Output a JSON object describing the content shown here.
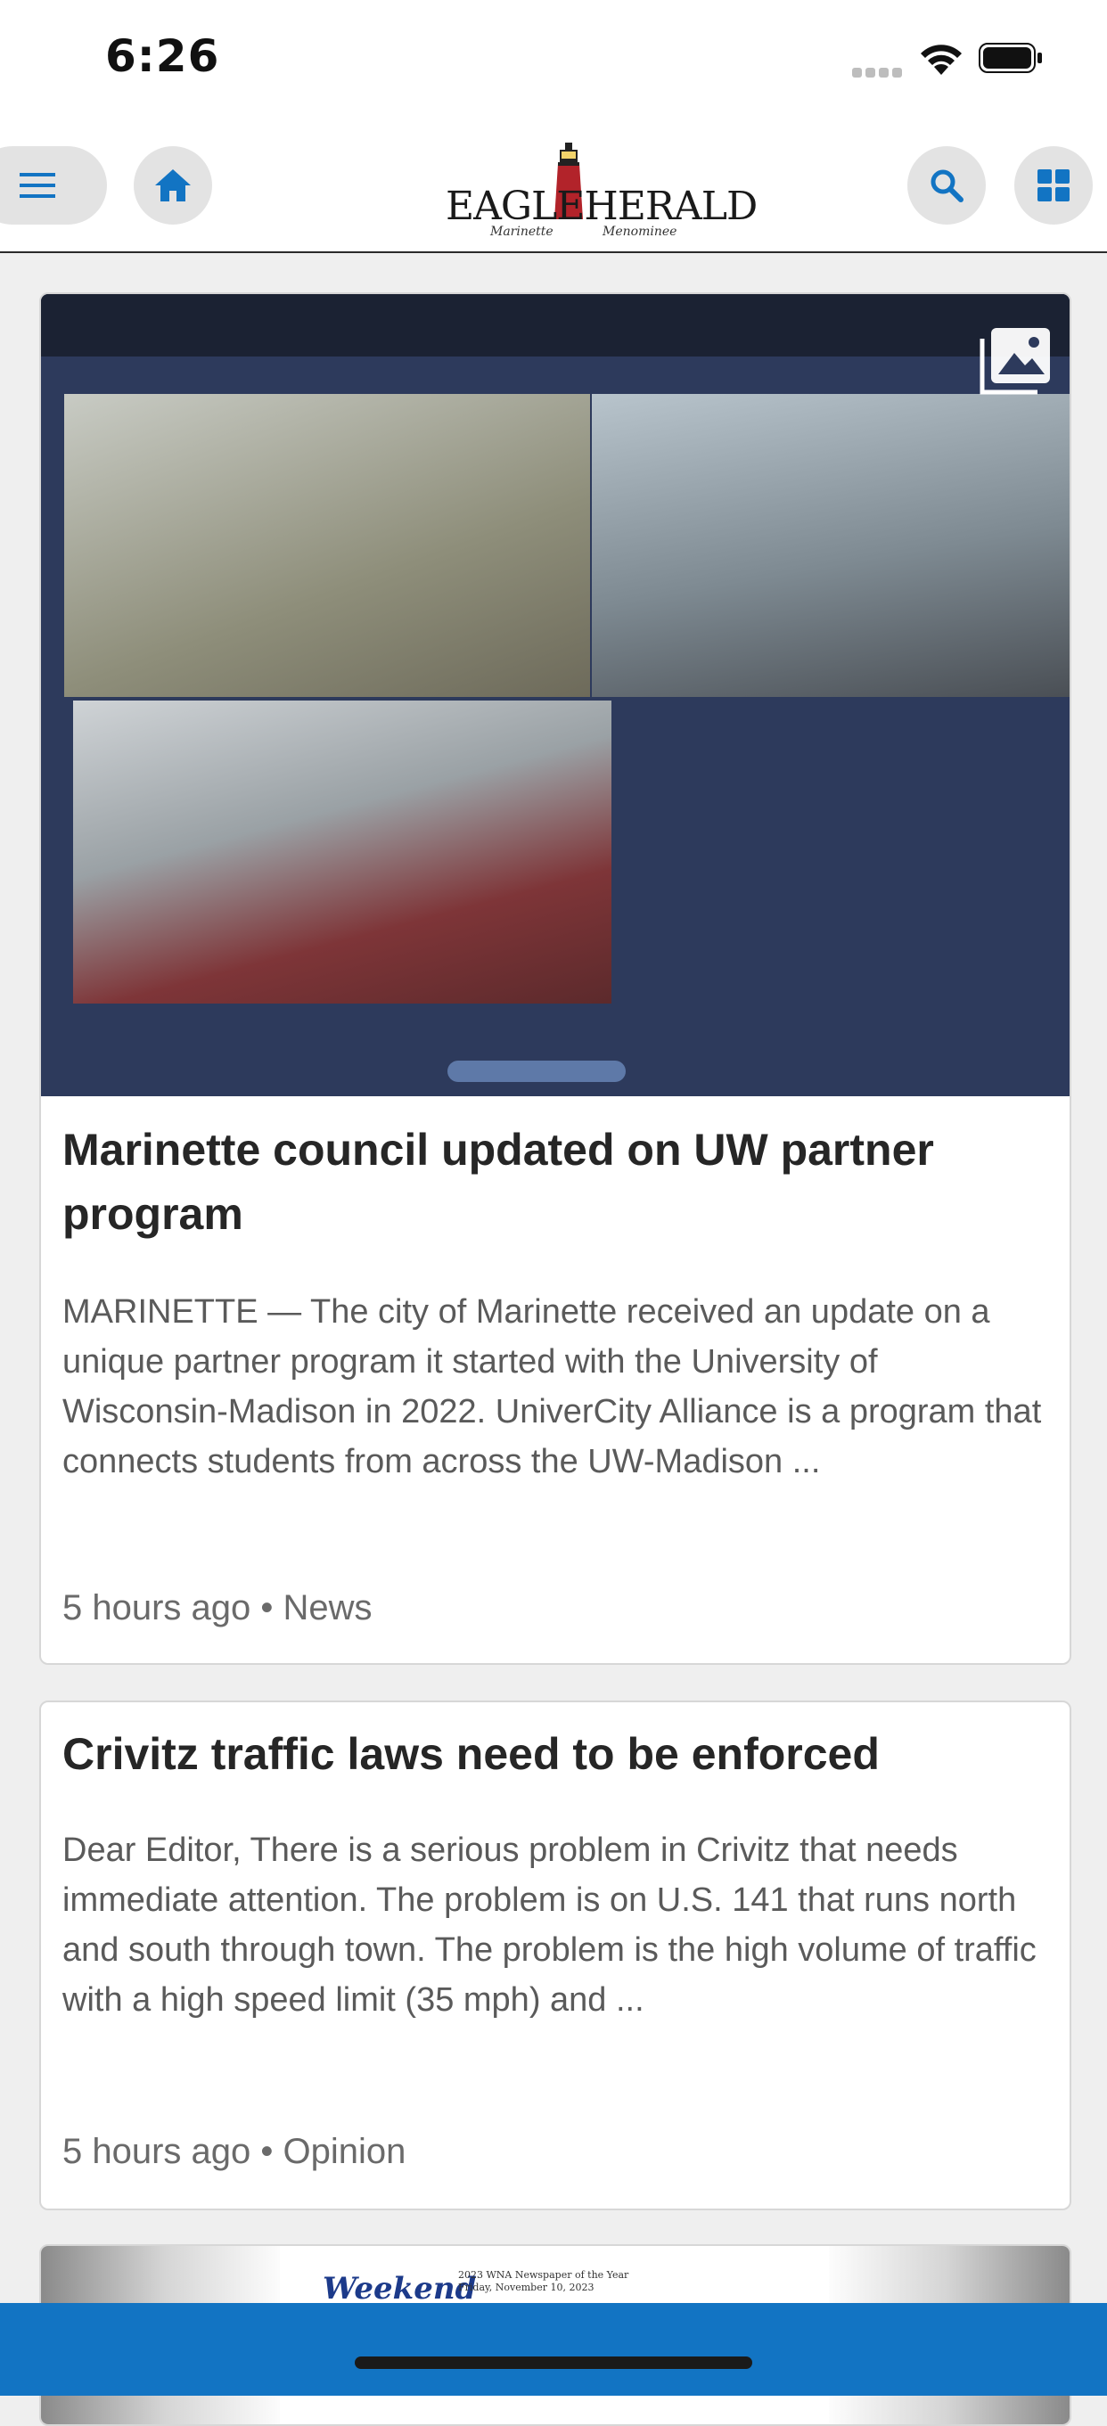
{
  "status_bar": {
    "time": "6:26"
  },
  "header": {
    "logo": {
      "main": "EAGLEHERALD",
      "sub_left": "Marinette",
      "sub_right": "Menominee"
    },
    "icons": [
      "menu-icon",
      "home-icon",
      "search-icon",
      "grid-icon"
    ],
    "accent": "#1274c3"
  },
  "articles": [
    {
      "headline": "Marinette council updated on UW partner program",
      "excerpt": "MARINETTE — The city of Marinette received an update on a unique partner program it started with the University of Wisconsin-Madison in 2022. UniverCity Alliance is a program that connects students from across the UW-Madison ...",
      "meta": "5 hours ago • News"
    },
    {
      "headline": "Crivitz traffic laws need to be enforced",
      "excerpt": "Dear Editor, There is a serious problem in Crivitz that needs immediate attention. The problem is on U.S. 141 that runs north and south through town. The problem is the high volume of traffic with a high speed limit (35 mph) and ...",
      "meta": "5 hours ago • Opinion"
    }
  ],
  "partial_card": {
    "title": "Weekend",
    "note": "2023 WNA Newspaper of the Year Friday, November 10, 2023"
  }
}
